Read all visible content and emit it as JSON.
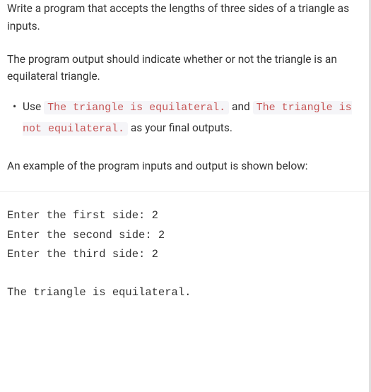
{
  "intro": {
    "p1": "Write a program that accepts the lengths of three sides of a triangle as inputs.",
    "p2": "The program output should indicate whether or not the triangle is an equilateral triangle."
  },
  "bullet": {
    "prefix": "Use ",
    "code1": "The triangle is equilateral.",
    "mid": " and ",
    "code2": "The triangle is not equilateral.",
    "suffix": " as your final outputs."
  },
  "example_lead": "An example of the program inputs and output is shown below:",
  "example": "Enter the first side: 2\nEnter the second side: 2\nEnter the third side: 2\n\nThe triangle is equilateral."
}
